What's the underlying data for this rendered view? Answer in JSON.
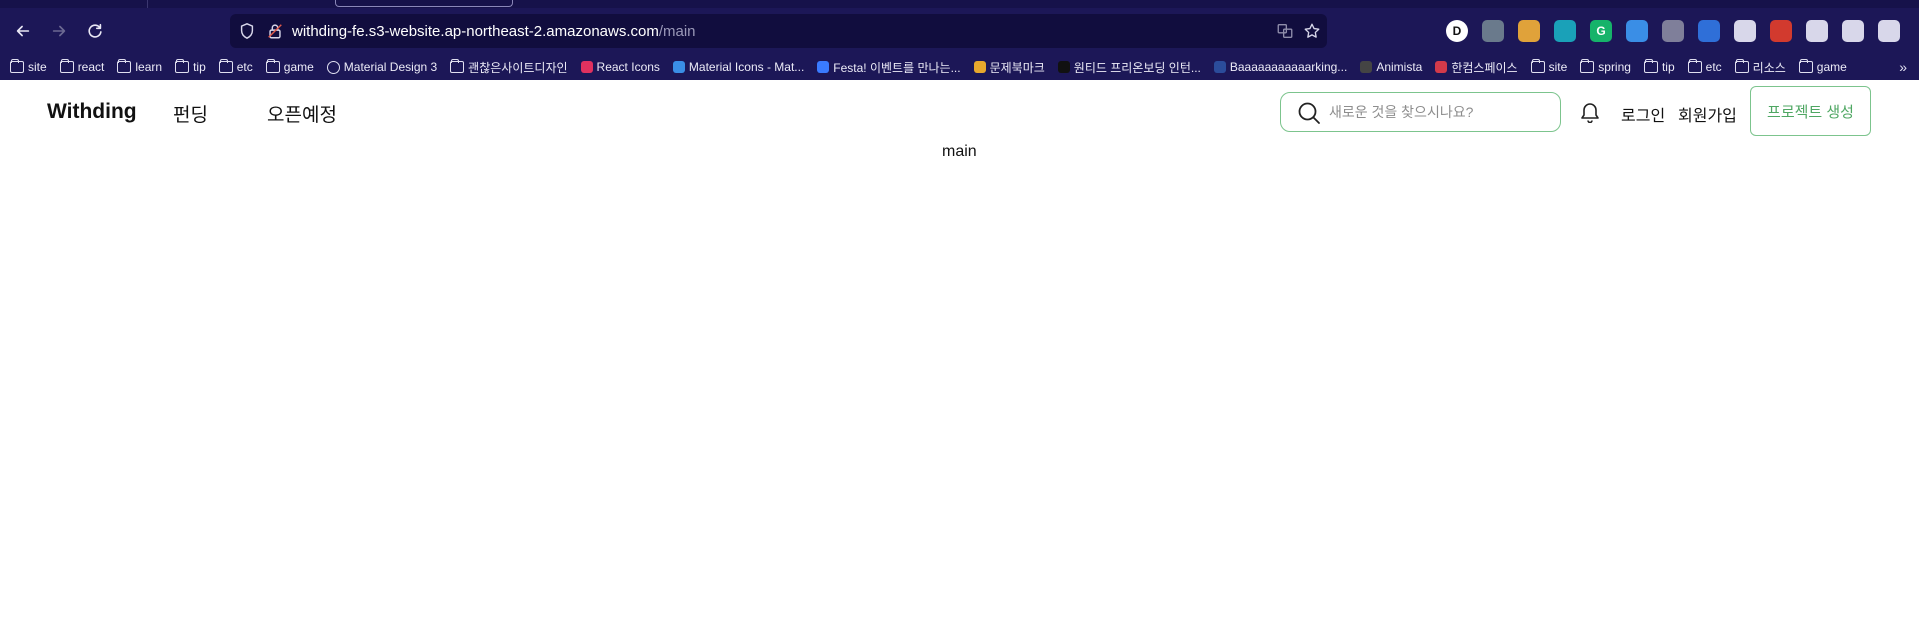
{
  "browser": {
    "url_host": "withding-fe.s3-website.ap-northeast-2.amazonaws.com",
    "url_path": "/main",
    "icons": [
      "back-icon",
      "forward-icon",
      "reload-icon",
      "shield-icon",
      "lock-icon",
      "translate-icon",
      "star-icon"
    ],
    "extensions": [
      {
        "label": "D",
        "color": "#ffffff",
        "text_color": "#111111"
      },
      {
        "label": "",
        "color": "#6a7a8c"
      },
      {
        "label": "",
        "color": "#e0a23a"
      },
      {
        "label": "",
        "color": "#1aa1b8"
      },
      {
        "label": "G",
        "color": "#16b36a"
      },
      {
        "label": "",
        "color": "#3a8ee6"
      },
      {
        "label": "",
        "color": "#7f7f9a"
      },
      {
        "label": "",
        "color": "#2f6fd8"
      },
      {
        "label": "",
        "color": "#d8d7ea"
      },
      {
        "label": "",
        "color": "#d23a2e"
      },
      {
        "label": "",
        "color": "#d8d7ea"
      },
      {
        "label": "",
        "color": "#d8d7ea"
      },
      {
        "label": "",
        "color": "#d8d7ea"
      }
    ],
    "bookmarks": [
      {
        "label": "site",
        "type": "folder"
      },
      {
        "label": "react",
        "type": "folder"
      },
      {
        "label": "learn",
        "type": "folder"
      },
      {
        "label": "tip",
        "type": "folder"
      },
      {
        "label": "etc",
        "type": "folder"
      },
      {
        "label": "game",
        "type": "folder"
      },
      {
        "label": "Material Design 3",
        "type": "globe"
      },
      {
        "label": "괜찮은사이트디자인",
        "type": "folder"
      },
      {
        "label": "React Icons",
        "type": "site",
        "color": "#e0315f"
      },
      {
        "label": "Material Icons - Mat...",
        "type": "site",
        "color": "#3a8ee6"
      },
      {
        "label": "Festa! 이벤트를 만나는...",
        "type": "site",
        "color": "#3a7bff"
      },
      {
        "label": "문제북마크",
        "type": "site",
        "color": "#e8a82d"
      },
      {
        "label": "원티드 프리온보딩 인턴...",
        "type": "site",
        "color": "#111111"
      },
      {
        "label": "Baaaaaaaaaaarking...",
        "type": "site",
        "color": "#2b4c9a"
      },
      {
        "label": "Animista",
        "type": "site",
        "color": "#444444"
      },
      {
        "label": "한컴스페이스",
        "type": "site",
        "color": "#d23a4a"
      },
      {
        "label": "site",
        "type": "folder"
      },
      {
        "label": "spring",
        "type": "folder"
      },
      {
        "label": "tip",
        "type": "folder"
      },
      {
        "label": "etc",
        "type": "folder"
      },
      {
        "label": "리소스",
        "type": "folder"
      },
      {
        "label": "game",
        "type": "folder"
      }
    ]
  },
  "header": {
    "logo": "Withding",
    "nav": [
      "펀딩",
      "오픈예정"
    ],
    "search_placeholder": "새로운 것을 찾으시나요?",
    "login": "로그인",
    "signup": "회원가입",
    "create_project": "프로젝트 생성",
    "accent_color": "#7cc48d"
  },
  "main": {
    "text": "main"
  }
}
